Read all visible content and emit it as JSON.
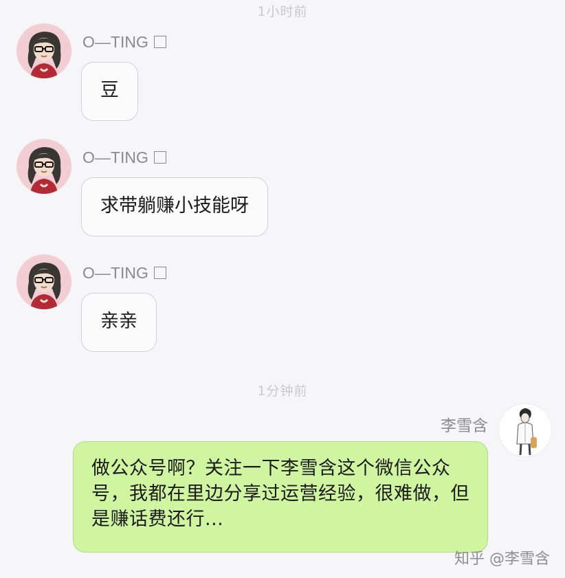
{
  "chat": {
    "divider_1": "1小时前",
    "divider_2": "1分钟前",
    "messages": [
      {
        "sender": "O—TING",
        "text": "豆"
      },
      {
        "sender": "O—TING",
        "text": "求带躺赚小技能呀"
      },
      {
        "sender": "O—TING",
        "text": "亲亲"
      },
      {
        "sender": "李雪含",
        "text": "做公众号啊？关注一下李雪含这个微信公众号，我都在里边分享过运营经验，很难做，但是赚话费还行..."
      }
    ]
  },
  "watermark": "知乎 @李雪含",
  "icons": {
    "avatar_left": "girl-with-glasses-avatar-icon",
    "avatar_right": "boy-sketch-avatar-icon",
    "name_badge": "square-box-icon"
  },
  "colors": {
    "background": "#f6f6f8",
    "incoming_bubble": "#fbfbfc",
    "outgoing_bubble": "#cff5a0",
    "avatar_bg": "#f2cdd3"
  }
}
